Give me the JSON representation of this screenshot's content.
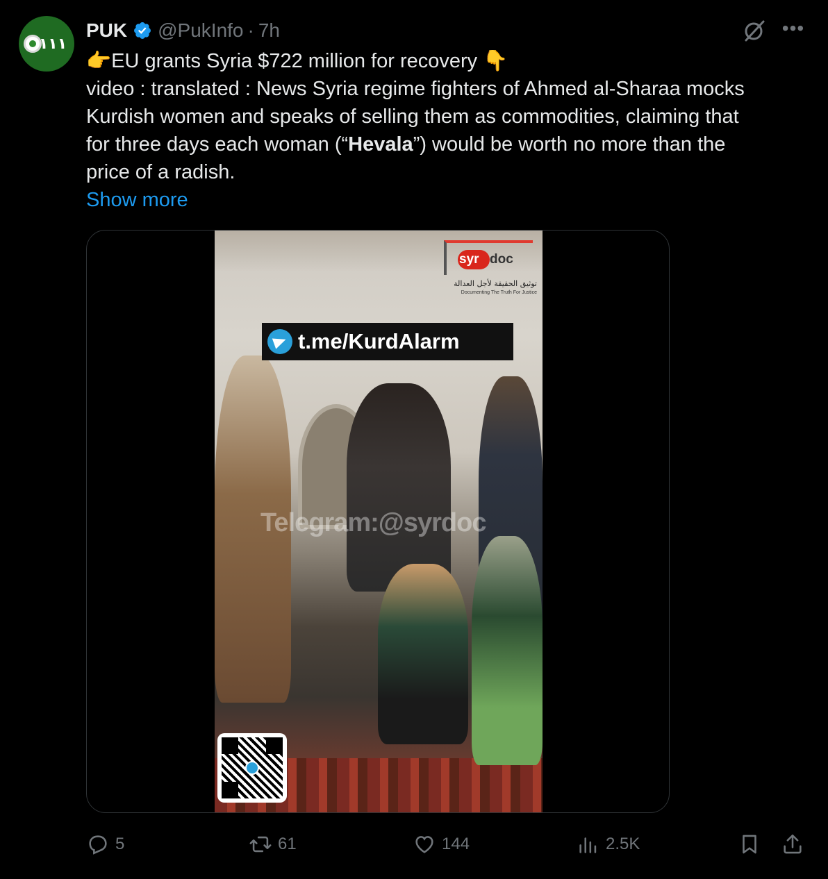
{
  "author": {
    "name": "PUK",
    "handle": "@PukInfo",
    "separator": "·",
    "time": "7h",
    "avatar_text": "١١١",
    "verified": true,
    "verified_color": "#1d9bf0"
  },
  "tweet": {
    "lines": [
      "👉EU grants Syria $722 million for recovery 👇",
      "video : translated : News Syria regime fighters of Ahmed al-Sharaa mocks",
      "Kurdish women and speaks of selling them as commodities, claiming that",
      "for three days each woman (“",
      "price of a radish."
    ],
    "bold_word": "Hevala",
    "line4_end": "”) would be worth no more than the",
    "show_more": "Show more"
  },
  "media": {
    "logo_syr": "syr",
    "logo_doc": "doc",
    "logo_arabic": "توثيق الحقيقة لأجل العدالة",
    "logo_english": "Documenting The Truth For Justice",
    "banner_text": "t.me/KurdAlarm",
    "watermark": "Telegram:@syrdoc"
  },
  "actions": {
    "reply_count": "5",
    "repost_count": "61",
    "like_count": "144",
    "views_count": "2.5K"
  },
  "icons": [
    "verified-badge-icon",
    "grok-icon",
    "more-icon",
    "reply-icon",
    "repost-icon",
    "like-icon",
    "views-icon",
    "bookmark-icon",
    "share-icon",
    "telegram-icon"
  ],
  "colors": {
    "background": "#000000",
    "text": "#e7e9ea",
    "muted": "#71767b",
    "link": "#1d9bf0"
  }
}
